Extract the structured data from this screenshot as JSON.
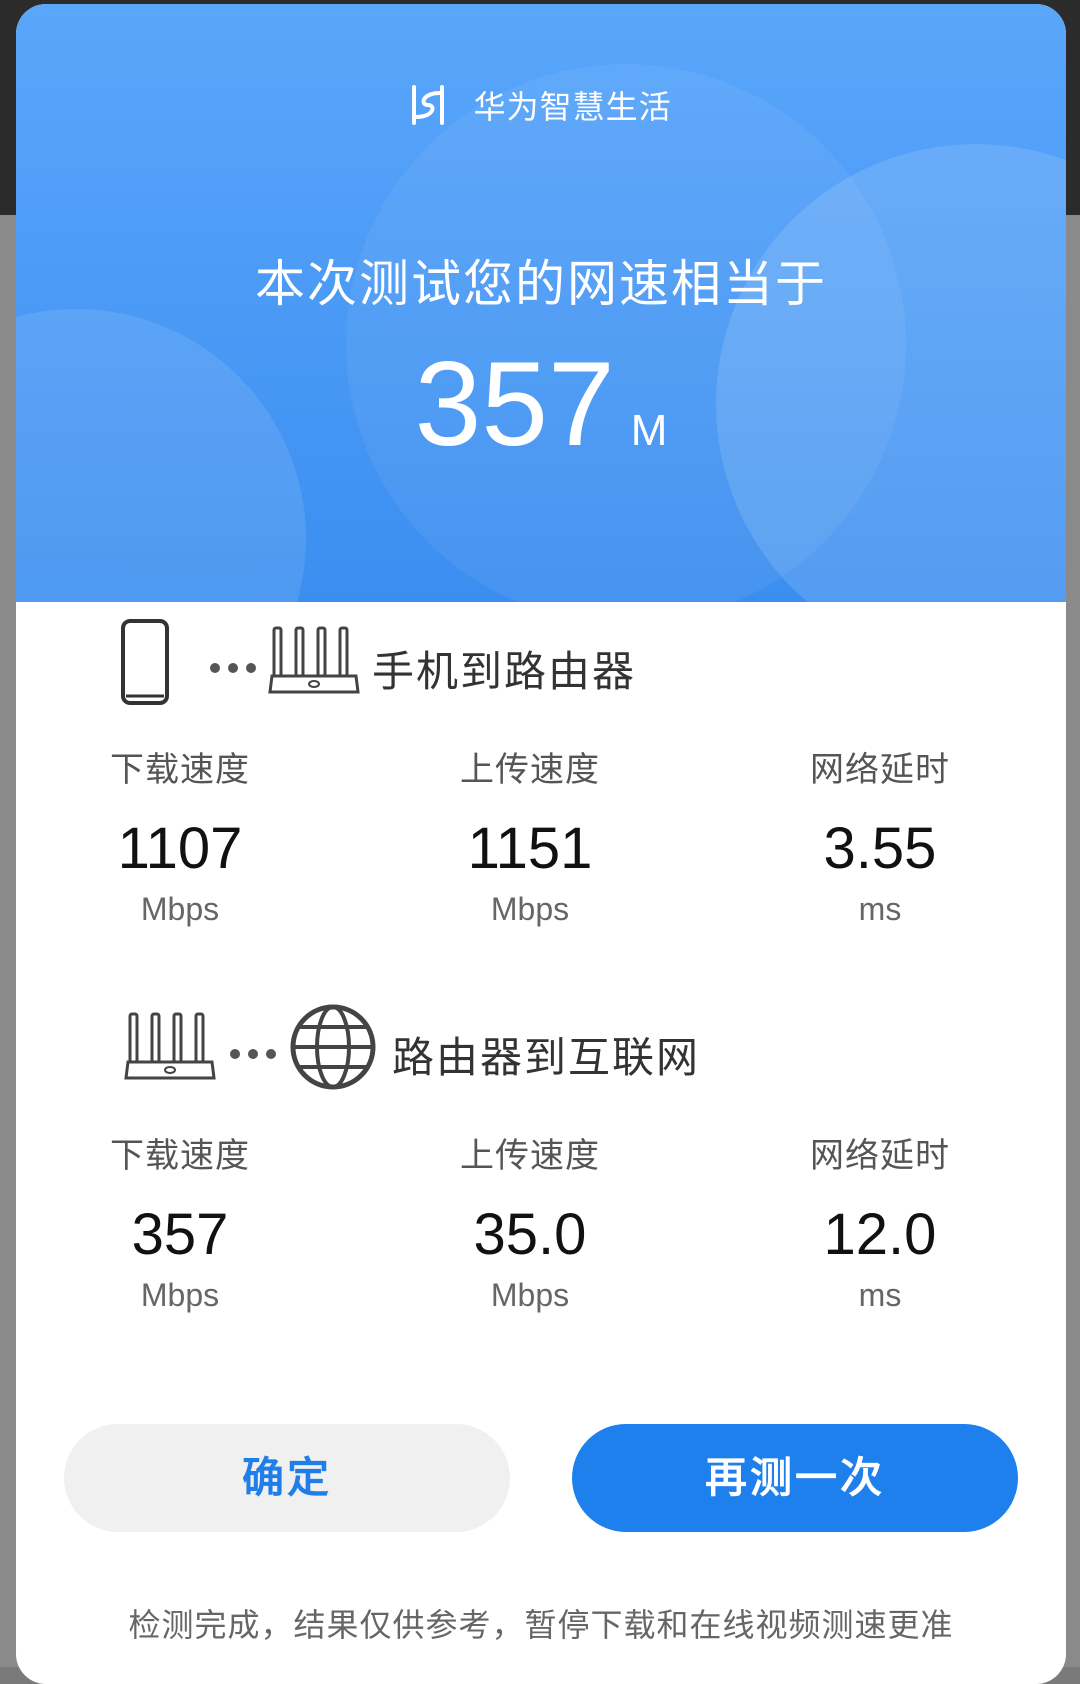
{
  "brand": {
    "name": "华为智慧生活"
  },
  "hero": {
    "headline": "本次测试您的网速相当于",
    "speed_value": "357",
    "speed_unit": "M"
  },
  "sections": [
    {
      "title": "手机到路由器",
      "icons": [
        "phone-icon",
        "router-icon"
      ],
      "metrics": [
        {
          "label": "下载速度",
          "value": "1107",
          "unit": "Mbps"
        },
        {
          "label": "上传速度",
          "value": "1151",
          "unit": "Mbps"
        },
        {
          "label": "网络延时",
          "value": "3.55",
          "unit": "ms"
        }
      ]
    },
    {
      "title": "路由器到互联网",
      "icons": [
        "router-icon",
        "globe-icon"
      ],
      "metrics": [
        {
          "label": "下载速度",
          "value": "357",
          "unit": "Mbps"
        },
        {
          "label": "上传速度",
          "value": "35.0",
          "unit": "Mbps"
        },
        {
          "label": "网络延时",
          "value": "12.0",
          "unit": "ms"
        }
      ]
    }
  ],
  "buttons": {
    "confirm": "确定",
    "retest": "再测一次"
  },
  "footnote": "检测完成，结果仅供参考，暂停下载和在线视频测速更准",
  "colors": {
    "hero_blue": "#3b8ef0",
    "accent_blue": "#1e80ec",
    "confirm_text": "#1f7ee8"
  }
}
